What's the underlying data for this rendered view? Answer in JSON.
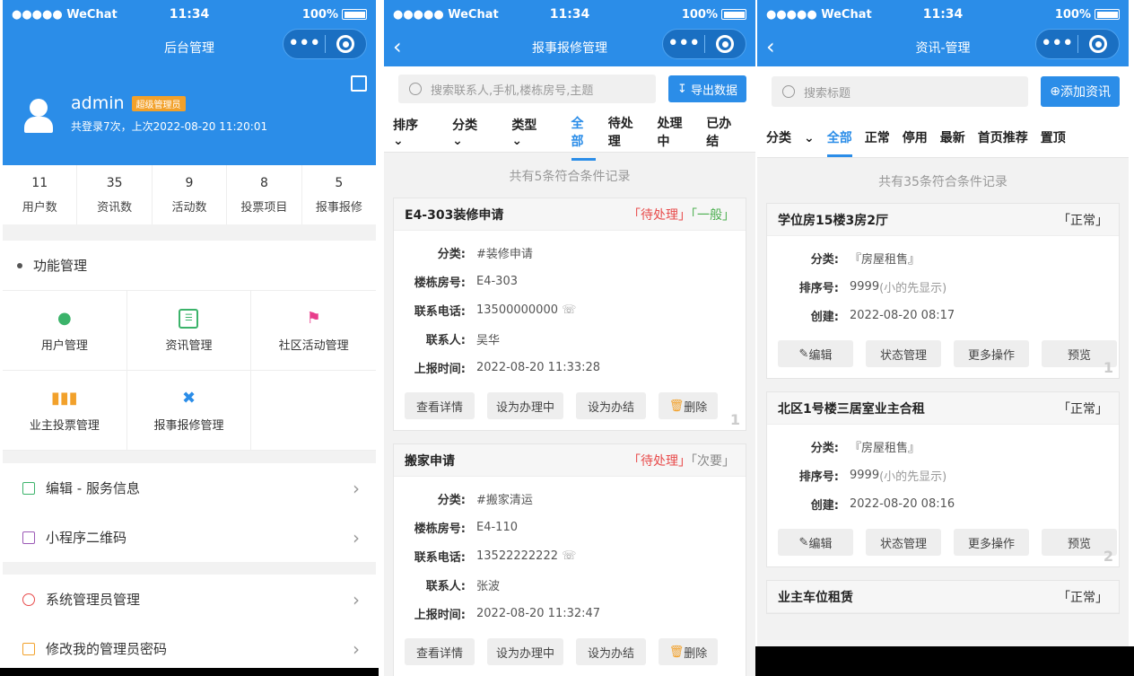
{
  "statusbar": {
    "carrier": "●●●●● WeChat",
    "time": "11:34",
    "battery": "100%"
  },
  "s1": {
    "title": "后台管理",
    "user": {
      "name": "admin",
      "badge": "超级管理员",
      "login_info": "共登录7次，上次2022-08-20 11:20:01"
    },
    "stats": [
      {
        "value": "11",
        "label": "用户数"
      },
      {
        "value": "35",
        "label": "资讯数"
      },
      {
        "value": "9",
        "label": "活动数"
      },
      {
        "value": "8",
        "label": "投票项目"
      },
      {
        "value": "5",
        "label": "报事报修"
      }
    ],
    "func_title": "功能管理",
    "func": [
      "用户管理",
      "资讯管理",
      "社区活动管理",
      "业主投票管理",
      "报事报修管理"
    ],
    "menu1": [
      "编辑 - 服务信息",
      "小程序二维码"
    ],
    "menu2": [
      "系统管理员管理",
      "修改我的管理员密码"
    ]
  },
  "s2": {
    "title": "报事报修管理",
    "search_placeholder": "搜索联系人,手机,楼栋房号,主题",
    "export": "导出数据",
    "tabs": [
      "排序",
      "分类",
      "类型",
      "全部",
      "待处理",
      "处理中",
      "已办结"
    ],
    "count": "共有5条符合条件记录",
    "labels": {
      "cat": "分类:",
      "room": "楼栋房号:",
      "phone": "联系电话:",
      "contact": "联系人:",
      "time": "上报时间:"
    },
    "buttons": [
      "查看详情",
      "设为办理中",
      "设为办结",
      "删除"
    ],
    "cards": [
      {
        "title": "E4-303装修申请",
        "status": "「待处理」",
        "level": "「一般」",
        "cat": "#装修申请",
        "room": "E4-303",
        "phone": "13500000000",
        "contact": "吴华",
        "time": "2022-08-20 11:33:28",
        "num": "1"
      },
      {
        "title": "搬家申请",
        "status": "「待处理」",
        "level": "「次要」",
        "cat": "#搬家清运",
        "room": "E4-110",
        "phone": "13522222222",
        "contact": "张波",
        "time": "2022-08-20 11:32:47",
        "num": "2"
      }
    ]
  },
  "s3": {
    "title": "资讯-管理",
    "search_placeholder": "搜索标题",
    "add": "添加资讯",
    "tabs": [
      "分类",
      "全部",
      "正常",
      "停用",
      "最新",
      "首页推荐",
      "置顶"
    ],
    "count": "共有35条符合条件记录",
    "labels": {
      "cat": "分类:",
      "order": "排序号:",
      "created": "创建:"
    },
    "buttons": [
      "编辑",
      "状态管理",
      "更多操作",
      "预览"
    ],
    "cards": [
      {
        "title": "学位房15楼3房2厅",
        "status": "「正常」",
        "cat": "『房屋租售』",
        "order": "9999",
        "order_hint": "(小的先显示)",
        "created": "2022-08-20 08:17",
        "num": "1"
      },
      {
        "title": "北区1号楼三居室业主合租",
        "status": "「正常」",
        "cat": "『房屋租售』",
        "order": "9999",
        "order_hint": "(小的先显示)",
        "created": "2022-08-20 08:16",
        "num": "2"
      },
      {
        "title": "业主车位租赁",
        "status": "「正常」"
      }
    ]
  }
}
